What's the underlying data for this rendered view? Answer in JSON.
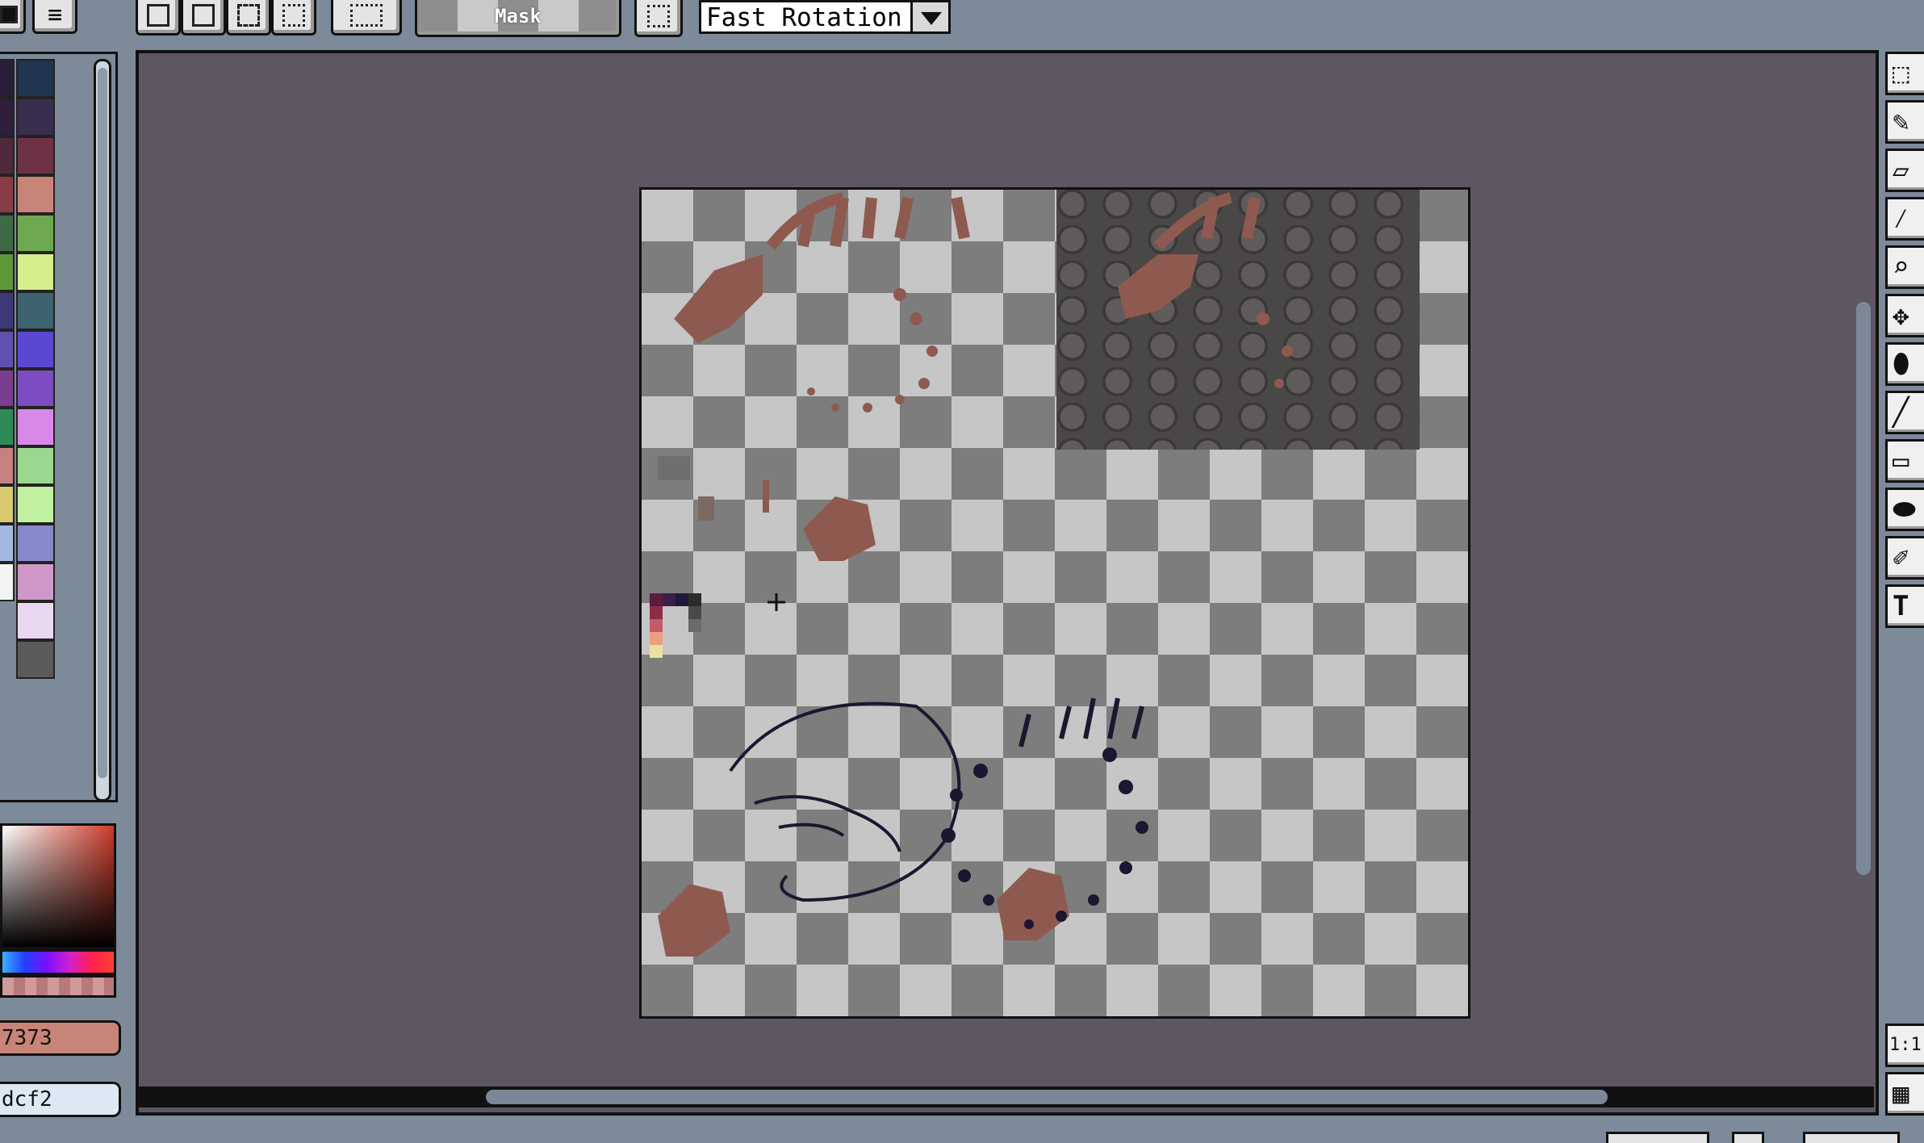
{
  "toolbar": {
    "menu_icon": "menu-icon",
    "mask_label": "Mask",
    "rotation_value": "Fast Rotation"
  },
  "palette": {
    "colors_left": [
      "#2a1f3a",
      "#2f1f3c",
      "#4f2a3d",
      "#8a3c44",
      "#3e6b45",
      "#5e9a3a",
      "#3e3a7a",
      "#6050b0",
      "#7a3d8f",
      "#2e8b57",
      "#c58080",
      "#d8c870",
      "#a0b8e0",
      "#f4f4f4"
    ],
    "colors_right": [
      "#1f3550",
      "#3a2e4e",
      "#6e3246",
      "#c88476",
      "#6ea850",
      "#d6ef8c",
      "#3d6270",
      "#5a48d0",
      "#7c4cc0",
      "#d888e8",
      "#9ad890",
      "#c0f0a0",
      "#8888cc",
      "#d098c8",
      "#ead8f0",
      "#5a5a5a"
    ]
  },
  "color_fields": {
    "primary_hex": "7373",
    "secondary_hex": "dcf2"
  },
  "zoom_button": "1:1",
  "tools": [
    "marquee-icon",
    "pencil-icon",
    "eraser-icon",
    "eyedropper-icon",
    "zoom-icon",
    "move-icon",
    "fill-icon",
    "line-icon",
    "rectangle-icon",
    "ellipse-icon",
    "brush-icon",
    "text-icon"
  ]
}
